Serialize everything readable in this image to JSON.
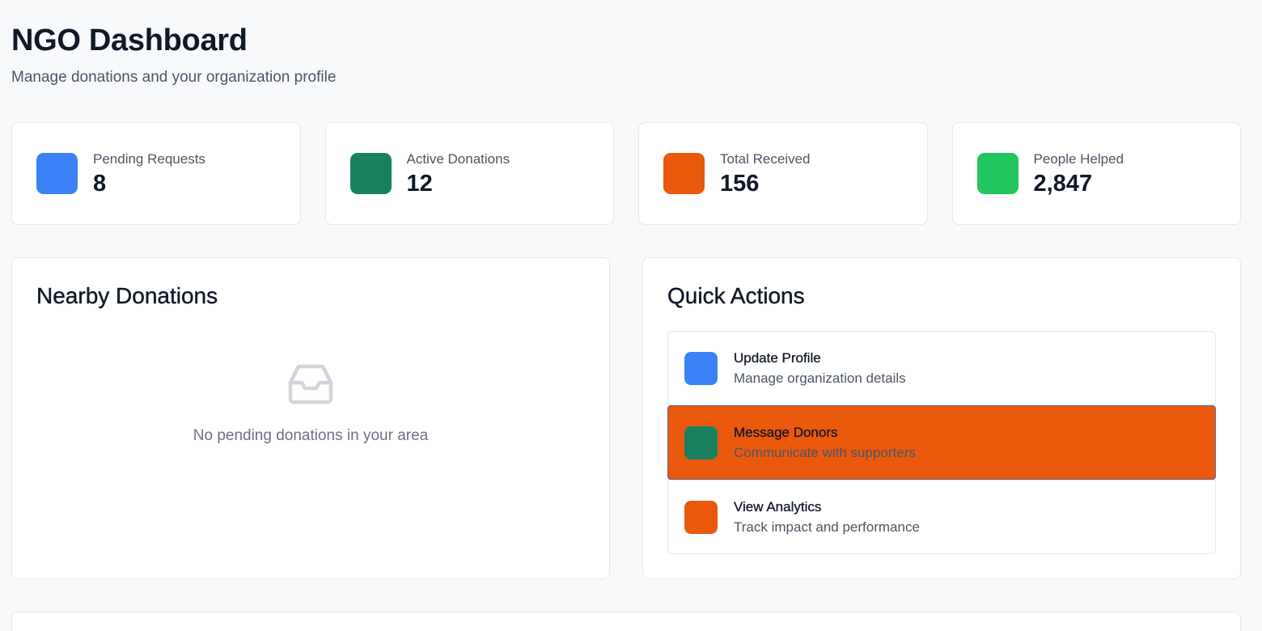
{
  "header": {
    "title": "NGO Dashboard",
    "subtitle": "Manage donations and your organization profile"
  },
  "stats": [
    {
      "label": "Pending Requests",
      "value": "8",
      "color": "#3b82f6"
    },
    {
      "label": "Active Donations",
      "value": "12",
      "color": "#1a8160"
    },
    {
      "label": "Total Received",
      "value": "156",
      "color": "#ea580c"
    },
    {
      "label": "People Helped",
      "value": "2,847",
      "color": "#22c55e"
    }
  ],
  "nearby": {
    "title": "Nearby Donations",
    "empty_icon": "inbox-icon",
    "empty_text": "No pending donations in your area"
  },
  "quick_actions": {
    "title": "Quick Actions",
    "items": [
      {
        "title": "Update Profile",
        "desc": "Manage organization details",
        "color": "#3b82f6"
      },
      {
        "title": "Message Donors",
        "desc": "Communicate with supporters",
        "color": "#1a8160",
        "active": true,
        "active_bg": "#ea580c"
      },
      {
        "title": "View Analytics",
        "desc": "Track impact and performance",
        "color": "#ea580c"
      }
    ]
  }
}
